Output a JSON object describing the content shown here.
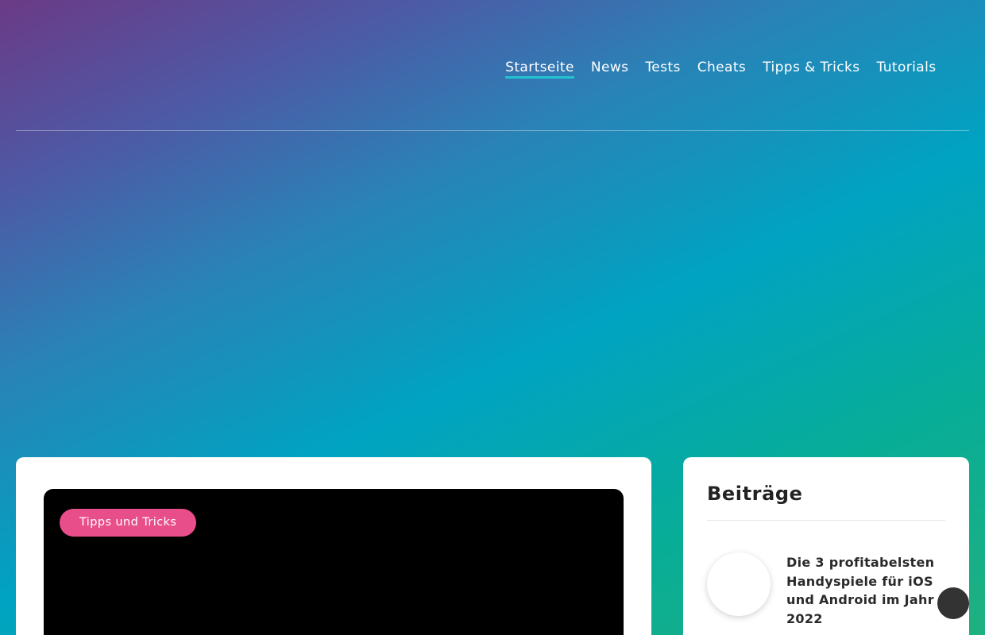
{
  "nav": {
    "items": [
      {
        "label": "Startseite",
        "active": true
      },
      {
        "label": "News",
        "active": false
      },
      {
        "label": "Tests",
        "active": false
      },
      {
        "label": "Cheats",
        "active": false
      },
      {
        "label": "Tipps & Tricks",
        "active": false
      },
      {
        "label": "Tutorials",
        "active": false
      }
    ]
  },
  "main": {
    "featured": {
      "category_label": "Tipps und Tricks"
    }
  },
  "sidebar": {
    "title": "Beiträge",
    "posts": [
      {
        "title": "Die 3 profitabelsten Handyspiele für iOS und Android im Jahr 2022"
      }
    ]
  },
  "colors": {
    "accent_underline": "#23c3d1",
    "badge": "#e84e8a",
    "scroll_button": "#333333"
  },
  "icons": {
    "scroll_top": "scroll-to-top-button"
  }
}
